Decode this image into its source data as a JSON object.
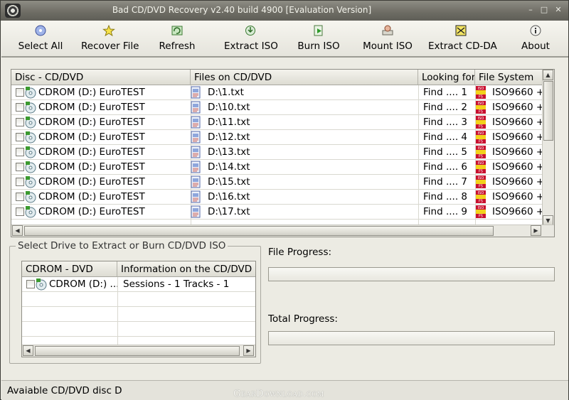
{
  "window": {
    "title": "Bad CD/DVD Recovery v2.40 build 4900 [Evaluation Version]",
    "controls": {
      "minimize": "–",
      "maximize": "□",
      "close": "✕"
    }
  },
  "toolbar": {
    "items": [
      {
        "label": "Select All",
        "icon": "cd-select-icon"
      },
      {
        "label": "Recover File",
        "icon": "star-icon"
      },
      {
        "label": "Refresh",
        "icon": "refresh-icon"
      },
      {
        "label": "Extract ISO",
        "icon": "extract-iso-icon"
      },
      {
        "label": "Burn ISO",
        "icon": "burn-iso-icon"
      },
      {
        "label": "Mount ISO",
        "icon": "mount-iso-icon"
      },
      {
        "label": "Extract CD-DA",
        "icon": "extract-cdda-icon"
      },
      {
        "label": "About",
        "icon": "info-icon"
      }
    ]
  },
  "files_table": {
    "columns": [
      "Disc - CD/DVD",
      "Files on CD/DVD",
      "Looking for",
      "File System"
    ],
    "rows": [
      {
        "disc": "CDROM (D:) EuroTEST",
        "file": "D:\\1.txt",
        "looking": "Find .... 1",
        "fs": "ISO9660 +"
      },
      {
        "disc": "CDROM (D:) EuroTEST",
        "file": "D:\\10.txt",
        "looking": "Find .... 2",
        "fs": "ISO9660 +"
      },
      {
        "disc": "CDROM (D:) EuroTEST",
        "file": "D:\\11.txt",
        "looking": "Find .... 3",
        "fs": "ISO9660 +"
      },
      {
        "disc": "CDROM (D:) EuroTEST",
        "file": "D:\\12.txt",
        "looking": "Find .... 4",
        "fs": "ISO9660 +"
      },
      {
        "disc": "CDROM (D:) EuroTEST",
        "file": "D:\\13.txt",
        "looking": "Find .... 5",
        "fs": "ISO9660 +"
      },
      {
        "disc": "CDROM (D:) EuroTEST",
        "file": "D:\\14.txt",
        "looking": "Find .... 6",
        "fs": "ISO9660 +"
      },
      {
        "disc": "CDROM (D:) EuroTEST",
        "file": "D:\\15.txt",
        "looking": "Find .... 7",
        "fs": "ISO9660 +"
      },
      {
        "disc": "CDROM (D:) EuroTEST",
        "file": "D:\\16.txt",
        "looking": "Find .... 8",
        "fs": "ISO9660 +"
      },
      {
        "disc": "CDROM (D:) EuroTEST",
        "file": "D:\\17.txt",
        "looking": "Find .... 9",
        "fs": "ISO9660 +"
      }
    ]
  },
  "drive_group": {
    "title": "Select Drive to Extract or Burn CD/DVD ISO",
    "columns": [
      "CDROM - DVD",
      "Information on the CD/DVD"
    ],
    "rows": [
      {
        "drive": "CDROM (D:) ...",
        "info": "Sessions - 1  Tracks - 1"
      }
    ]
  },
  "progress": {
    "file_label": "File Progress:",
    "file_value": 0,
    "total_label": "Total Progress:",
    "total_value": 0
  },
  "status": {
    "text": "Avaiable CD/DVD disc D"
  },
  "watermark": "GearDownload.com",
  "colors": {
    "titlebar": "#6d6c64",
    "window_bg": "#ecebe3",
    "iso_red": "#c8102e",
    "iso_yellow": "#f2d21b"
  }
}
